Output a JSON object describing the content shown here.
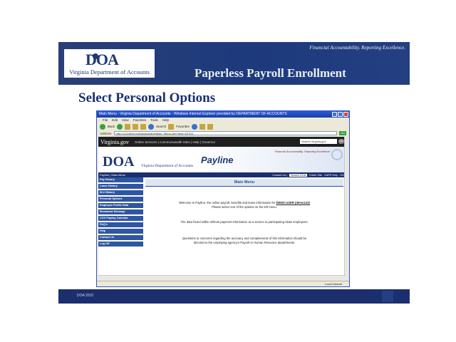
{
  "slide": {
    "tagline": "Financial Accountability. Reporting Excellence.",
    "logo_doa": "DOA",
    "logo_name": "Virginia Department of Accounts",
    "title": "Paperless Payroll Enrollment",
    "section_heading": "Select Personal Options",
    "footer_text": "DOA 2010"
  },
  "browser": {
    "window_title": "Main Menu - Virginia Department of Accounts - Windows Internet Explorer provided by DEPARTMENT OF ACCOUNTS",
    "menu": [
      "File",
      "Edit",
      "View",
      "Favorites",
      "Tools",
      "Help"
    ],
    "toolbar": {
      "back": "Back",
      "search": "Search",
      "favorites": "Favorites"
    },
    "address_label": "Address",
    "address_value": "http://o12cbbm.hothimplpayline/Main_Menu.cfm?item=D1910",
    "go_label": "Go",
    "status_text": "Local intranet"
  },
  "site": {
    "vagov_logo": "Virginia.gov",
    "vagov_links": "Online Services | Commonwealth Sites | Help | Governor",
    "vagov_search_placeholder": "Search Virginia.gov",
    "vagov_go": "GO",
    "banner_doa": "DOA",
    "banner_vdoa": "Virginia Department of Accounts",
    "banner_payline": "Payline",
    "banner_tagline": "Financial Accountability. Reporting Excellence",
    "nav_left": "Payline | Main Menu",
    "nav_contact": "Contact Us |",
    "nav_search": "Search DOA",
    "nav_entire": "Entire Site",
    "nav_cafr": "CAFR Only",
    "nav_go": "GO"
  },
  "leftnav": {
    "items": [
      "Pay History",
      "Leave History",
      "W-2 History",
      "Personal Options",
      "Employee Profile Data",
      "Broadcast Message",
      "COV Payday Calendar",
      "FAQ's",
      "Help",
      "Contact Us",
      "Log Off"
    ]
  },
  "content": {
    "heading": "Main Menu",
    "line1a": "Welcome to Payline, the online payroll, benefits and leave information for",
    "demo_user": "DEMO USER (demo123)",
    "line1b": "Please select one of the options on the left menu.",
    "line2": "The data found within reflects payment information as a service to participating State employees.",
    "line3a": "Questions or concerns regarding the accuracy and completeness of this information should be",
    "line3b": "directed to the employing agency's Payroll or Human Resource departments."
  }
}
